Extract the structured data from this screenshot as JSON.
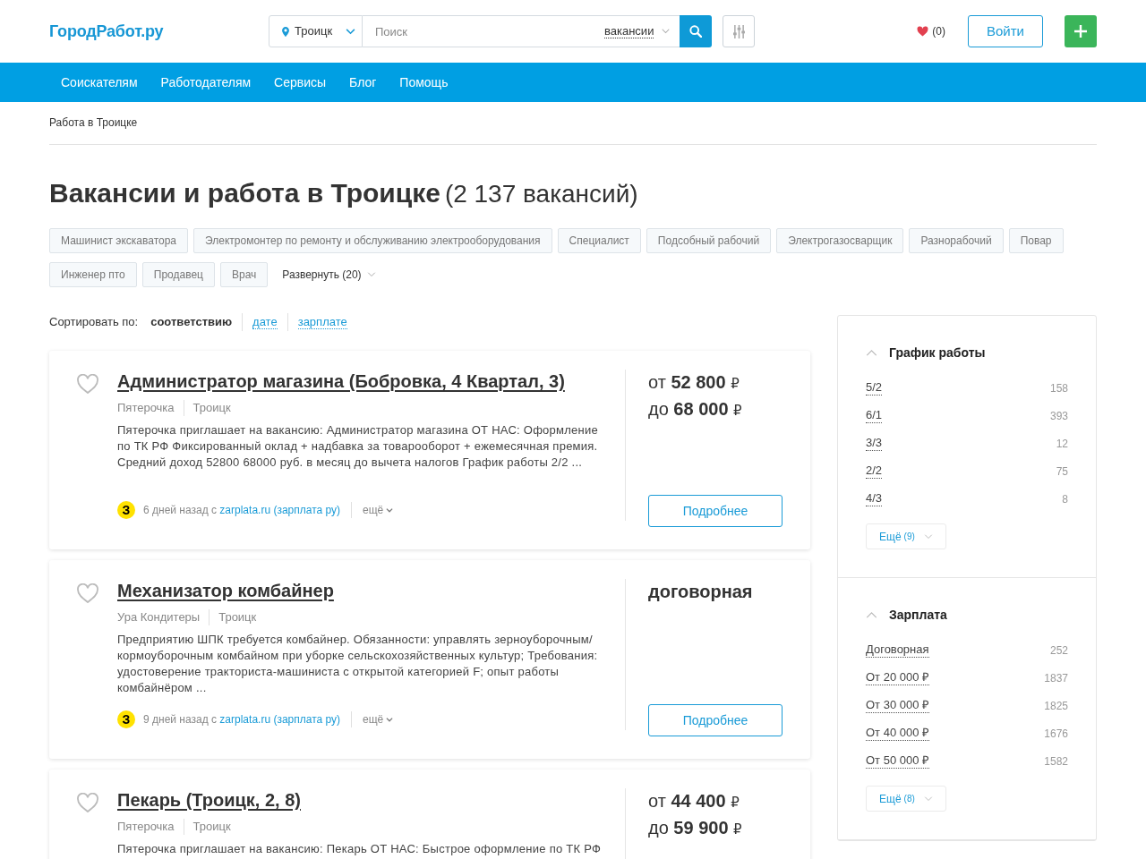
{
  "header": {
    "logo": "ГородРабот.ру",
    "city": "Троицк",
    "search_placeholder": "Поиск",
    "search_scope": "вакансии",
    "favorites_count": "(0)",
    "login": "Войти"
  },
  "nav": [
    "Соискателям",
    "Работодателям",
    "Сервисы",
    "Блог",
    "Помощь"
  ],
  "breadcrumb": "Работа в Троицке",
  "heading": {
    "title": "Вакансии и работа в Троицке",
    "count": "(2 137 вакансий)"
  },
  "tags": [
    "Машинист экскаватора",
    "Электромонтер по ремонту и обслуживанию электрооборудования",
    "Специалист",
    "Подсобный рабочий",
    "Электрогазосварщик",
    "Разнорабочий",
    "Повар",
    "Инженер пто",
    "Продавец",
    "Врач"
  ],
  "expand_tags": "Развернуть (20)",
  "sort": {
    "label": "Сортировать по:",
    "options": [
      {
        "label": "соответствию",
        "selected": true
      },
      {
        "label": "дате",
        "selected": false
      },
      {
        "label": "зарплате",
        "selected": false
      }
    ]
  },
  "vacancies": [
    {
      "title": "Администратор магазина (Бобровка, 4 Квартал, 3)",
      "saved": false,
      "company": "Пятерочка",
      "city": "Троицк",
      "description": "Пятерочка приглашает на вакансию: Администратор магазина ОТ НАС: Оформление по ТК РФ Фиксированный оклад + надбавка за товарооборот + ежемесячная премия. Средний доход 52800 68000 руб. в месяц до вычета налогов График работы 2/2 ...",
      "source_logo": "З",
      "posted": "6 дней назад с",
      "source_link": "zarplata.ru (зарплата ру)",
      "more": "ещё",
      "salary": {
        "kind": "range",
        "from_prefix": "от",
        "from": "52 800",
        "to_prefix": "до",
        "to": "68 000",
        "currency": "₽"
      },
      "button": "Подробнее"
    },
    {
      "title": "Механизатор комбайнер",
      "saved": false,
      "company": "Ура Кондитеры",
      "city": "Троицк",
      "description": "Предприятию ШПК требуется комбайнер. Обязанности: управлять зерноуборочным/кормоуборочным комбайном при уборке сельскохозяйственных культур; Требования: удостоверение тракториста-машиниста с открытой категорией F; опыт работы комбайнёром ...",
      "source_logo": "З",
      "posted": "9 дней назад с",
      "source_link": "zarplata.ru (зарплата ру)",
      "more": "ещё",
      "salary": {
        "kind": "text",
        "text": "договорная"
      },
      "button": "Подробнее"
    },
    {
      "title": "Пекарь (Троицк, 2, 8)",
      "saved": false,
      "company": "Пятерочка",
      "city": "Троицк",
      "description": "Пятерочка приглашает на вакансию: Пекарь ОТ НАС: Быстрое оформление по ТК РФ",
      "salary": {
        "kind": "range",
        "from_prefix": "от",
        "from": "44 400",
        "to_prefix": "до",
        "to": "59 900",
        "currency": "₽"
      }
    }
  ],
  "filters": [
    {
      "title": "График работы",
      "expanded": true,
      "items": [
        {
          "label": "5/2",
          "count": "158"
        },
        {
          "label": "6/1",
          "count": "393"
        },
        {
          "label": "3/3",
          "count": "12"
        },
        {
          "label": "2/2",
          "count": "75"
        },
        {
          "label": "4/3",
          "count": "8"
        }
      ],
      "more_label": "Ещё",
      "more_count": "(9)"
    },
    {
      "title": "Зарплата",
      "expanded": true,
      "items": [
        {
          "label": "Договорная",
          "count": "252"
        },
        {
          "label": "От 20 000 ₽",
          "count": "1837"
        },
        {
          "label": "От 30 000 ₽",
          "count": "1825"
        },
        {
          "label": "От 40 000 ₽",
          "count": "1676"
        },
        {
          "label": "От 50 000 ₽",
          "count": "1582"
        }
      ],
      "more_label": "Ещё",
      "more_count": "(8)"
    }
  ]
}
